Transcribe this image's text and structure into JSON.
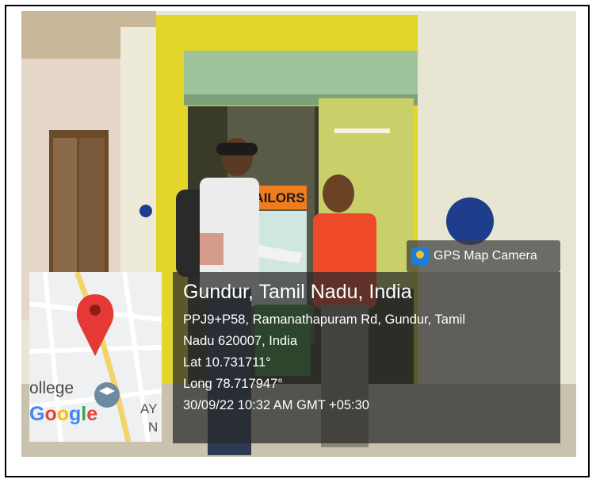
{
  "overlay": {
    "app_label": "GPS Map Camera",
    "app_icon": "gps-map-camera-icon",
    "location_title": "Gundur, Tamil Nadu, India",
    "address_line1": "PPJ9+P58, Ramanathapuram Rd, Gundur, Tamil",
    "address_line2": "Nadu 620007, India",
    "latitude": "Lat 10.731711°",
    "longitude": "Long 78.717947°",
    "datetime": "30/09/22 10:32 AM GMT +05:30"
  },
  "map": {
    "college_text": "ollege",
    "google_letters": [
      "G",
      "o",
      "o",
      "g",
      "l",
      "e"
    ],
    "google_colors": [
      "#4285F4",
      "#EA4335",
      "#FBBC05",
      "#4285F4",
      "#34A853",
      "#EA4335"
    ],
    "edge_text_1": "AY",
    "edge_text_2": "N",
    "pin_color": "#e53935"
  },
  "scene": {
    "shop_sign": "TAILORS",
    "sign_color": "#f07c1e"
  }
}
